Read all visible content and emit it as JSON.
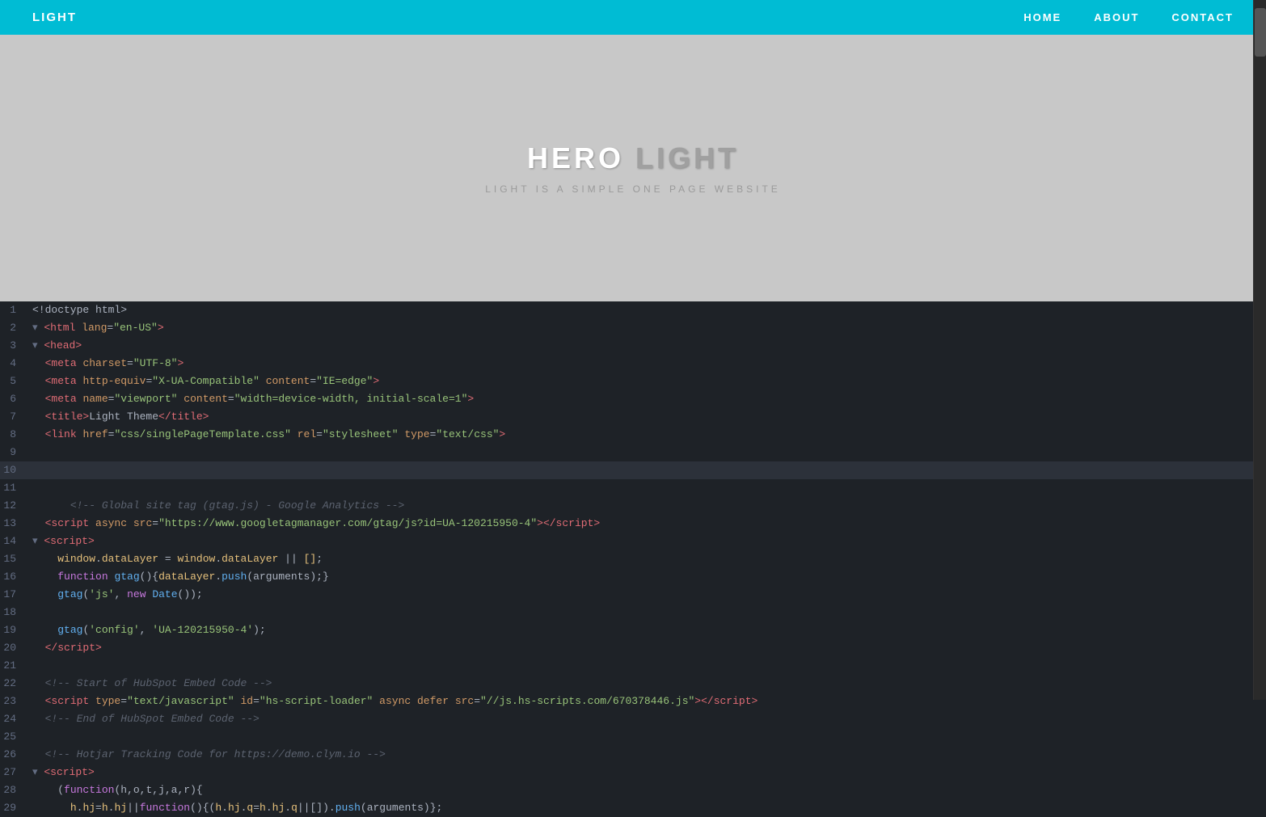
{
  "nav": {
    "logo": "LIGHT",
    "links": [
      {
        "label": "HOME",
        "name": "nav-home"
      },
      {
        "label": "ABOUT",
        "name": "nav-about"
      },
      {
        "label": "CONTACT",
        "name": "nav-contact"
      }
    ]
  },
  "hero": {
    "title_part1": "HERO",
    "title_part2": "LIGHT",
    "subtitle": "LIGHT IS A SIMPLE ONE PAGE WEBSITE"
  },
  "code": {
    "lines": [
      {
        "num": 1,
        "html": "<!doctype html>",
        "highlight": false
      },
      {
        "num": 2,
        "html": "&lt;html lang=&quot;en-US&quot;&gt;",
        "highlight": false
      },
      {
        "num": 3,
        "html": "&lt;head&gt;",
        "highlight": false
      },
      {
        "num": 4,
        "html": "  &lt;meta charset=&quot;UTF-8&quot;&gt;",
        "highlight": false
      },
      {
        "num": 5,
        "html": "  &lt;meta http-equiv=&quot;X-UA-Compatible&quot; content=&quot;IE=edge&quot;&gt;",
        "highlight": false
      },
      {
        "num": 6,
        "html": "  &lt;meta name=&quot;viewport&quot; content=&quot;width=device-width, initial-scale=1&quot;&gt;",
        "highlight": false
      },
      {
        "num": 7,
        "html": "  &lt;title&gt;Light Theme&lt;/title&gt;",
        "highlight": false
      },
      {
        "num": 8,
        "html": "  &lt;link href=&quot;css/singlePageTemplate.css&quot; rel=&quot;stylesheet&quot; type=&quot;text/css&quot;&gt;",
        "highlight": false
      },
      {
        "num": 9,
        "html": "",
        "highlight": false
      },
      {
        "num": 10,
        "html": "",
        "highlight": true
      },
      {
        "num": 11,
        "html": "",
        "highlight": false
      },
      {
        "num": 12,
        "html": "    &lt;!-- Global site tag (gtag.js) - Google Analytics --&gt;",
        "highlight": false
      },
      {
        "num": 13,
        "html": "  &lt;script async src=&quot;https://www.googletagmanager.com/gtag/js?id=UA-120215950-4&quot;&gt;&lt;/script&gt;",
        "highlight": false
      },
      {
        "num": 14,
        "html": "  &lt;script&gt;",
        "highlight": false
      },
      {
        "num": 15,
        "html": "    window.dataLayer = window.dataLayer || [];",
        "highlight": false
      },
      {
        "num": 16,
        "html": "    function gtag(){dataLayer.push(arguments);}",
        "highlight": false
      },
      {
        "num": 17,
        "html": "    gtag('js', new Date());",
        "highlight": false
      },
      {
        "num": 18,
        "html": "",
        "highlight": false
      },
      {
        "num": 19,
        "html": "    gtag('config', 'UA-120215950-4');",
        "highlight": false
      },
      {
        "num": 20,
        "html": "  &lt;/script&gt;",
        "highlight": false
      },
      {
        "num": 21,
        "html": "",
        "highlight": false
      },
      {
        "num": 22,
        "html": "  &lt;!-- Start of HubSpot Embed Code --&gt;",
        "highlight": false
      },
      {
        "num": 23,
        "html": "  &lt;script type=&quot;text/javascript&quot; id=&quot;hs-script-loader&quot; async defer src=&quot;//js.hs-scripts.com/670378446.js&quot;&gt;&lt;/script&gt;",
        "highlight": false
      },
      {
        "num": 24,
        "html": "  &lt;!-- End of HubSpot Embed Code --&gt;",
        "highlight": false
      },
      {
        "num": 25,
        "html": "",
        "highlight": false
      },
      {
        "num": 26,
        "html": "  &lt;!-- Hotjar Tracking Code for https://demo.clym.io --&gt;",
        "highlight": false
      },
      {
        "num": 27,
        "html": "  &lt;script&gt;",
        "highlight": false
      },
      {
        "num": 28,
        "html": "    (function(h,o,t,j,a,r){",
        "highlight": false
      },
      {
        "num": 29,
        "html": "      h.hj=h.hj||function(){(h.hj.q=h.hj.q||[]).push(arguments)};",
        "highlight": false
      }
    ]
  }
}
